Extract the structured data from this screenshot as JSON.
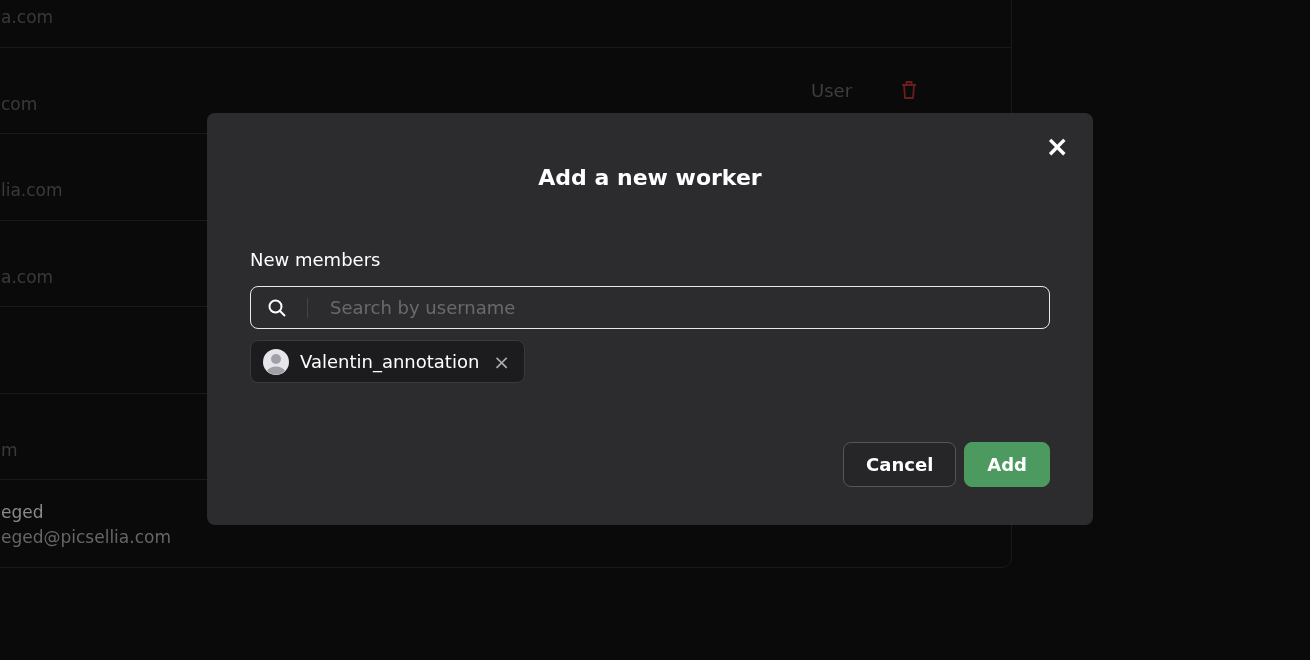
{
  "members_table": {
    "rows": [
      {
        "email": "a.com",
        "dimmed": true
      },
      {
        "email": "com",
        "dimmed": true,
        "role": "User"
      },
      {
        "email": "lia.com",
        "dimmed": true
      },
      {
        "email": "a.com",
        "dimmed": true
      },
      {},
      {
        "email": "m",
        "dimmed": true
      },
      {
        "name": "eged",
        "email": "eged@picsellia.com",
        "dimmed": false
      }
    ]
  },
  "dialog": {
    "title": "Add a new worker",
    "close": "×",
    "field_label": "New members",
    "search": {
      "placeholder": "Search by username"
    },
    "chips": [
      {
        "label": "Valentin_annotation",
        "remove": "×"
      }
    ],
    "buttons": [
      {
        "label": "Cancel",
        "kind": "secondary"
      },
      {
        "label": "Add",
        "kind": "primary"
      }
    ]
  }
}
